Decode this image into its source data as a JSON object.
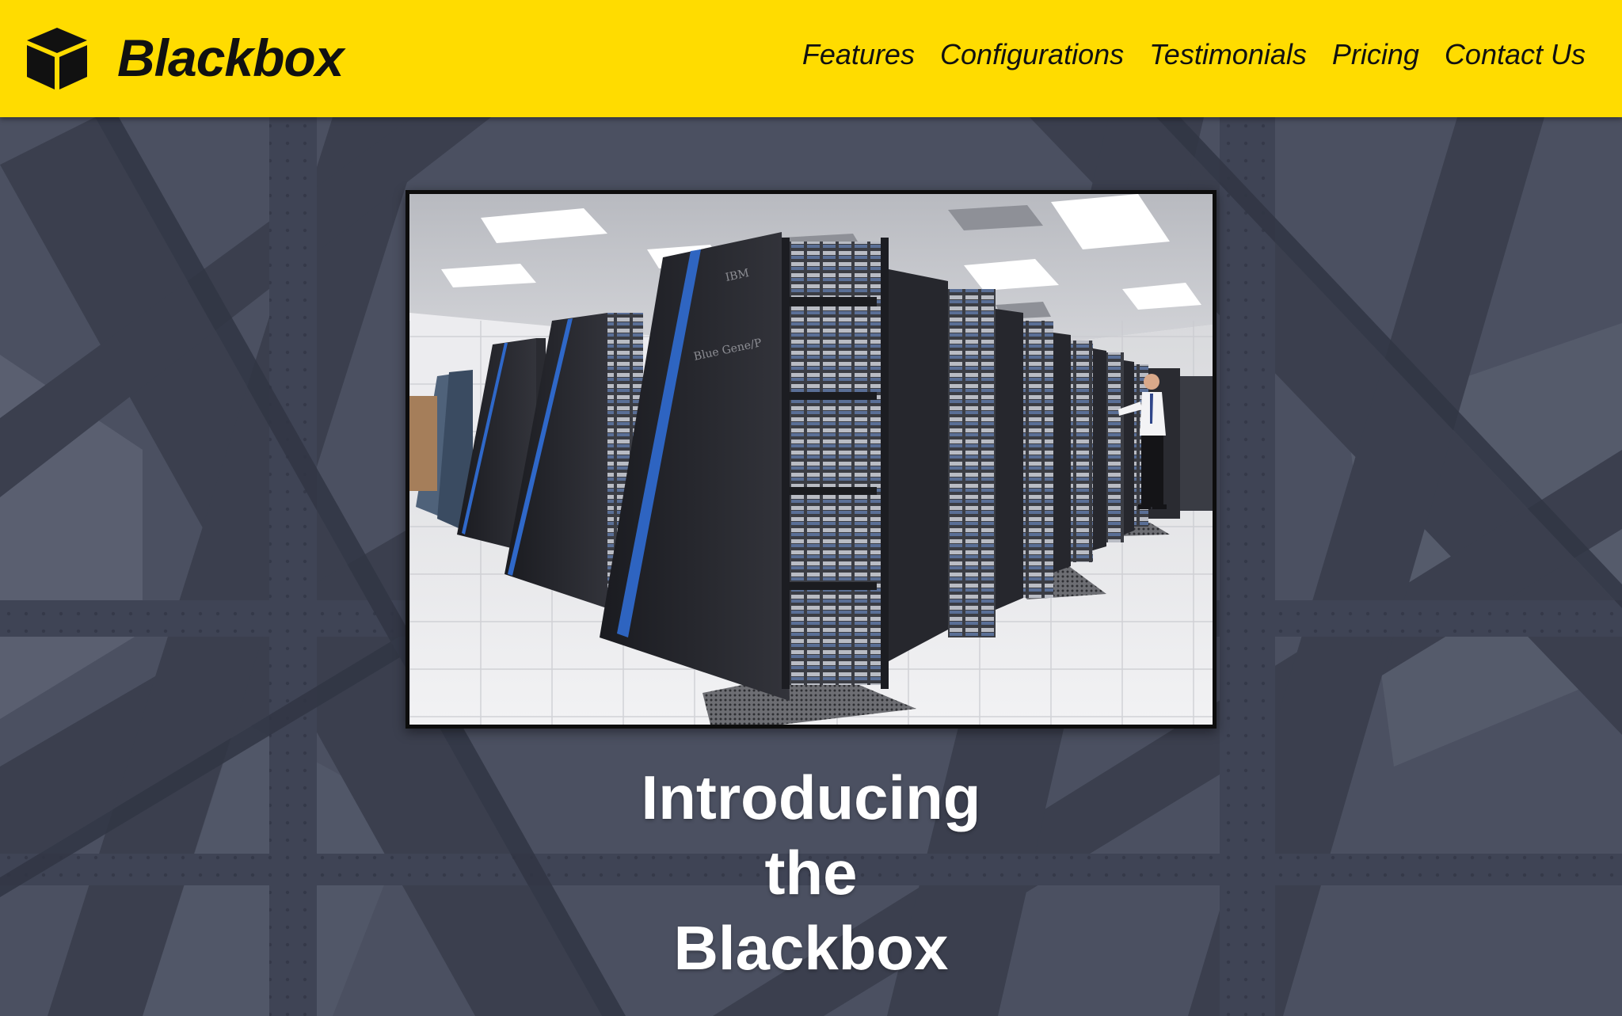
{
  "brand": {
    "name": "Blackbox",
    "logo_icon": "cube-icon"
  },
  "nav": {
    "items": [
      {
        "label": "Features"
      },
      {
        "label": "Configurations"
      },
      {
        "label": "Testimonials"
      },
      {
        "label": "Pricing"
      },
      {
        "label": "Contact Us"
      }
    ]
  },
  "hero": {
    "heading_lines": [
      "Introducing",
      "the",
      "Blackbox"
    ]
  },
  "colors": {
    "navbar": "#ffdc00",
    "nav_text": "#111111",
    "hero_overlay": "#525766",
    "heading": "#ffffff"
  }
}
